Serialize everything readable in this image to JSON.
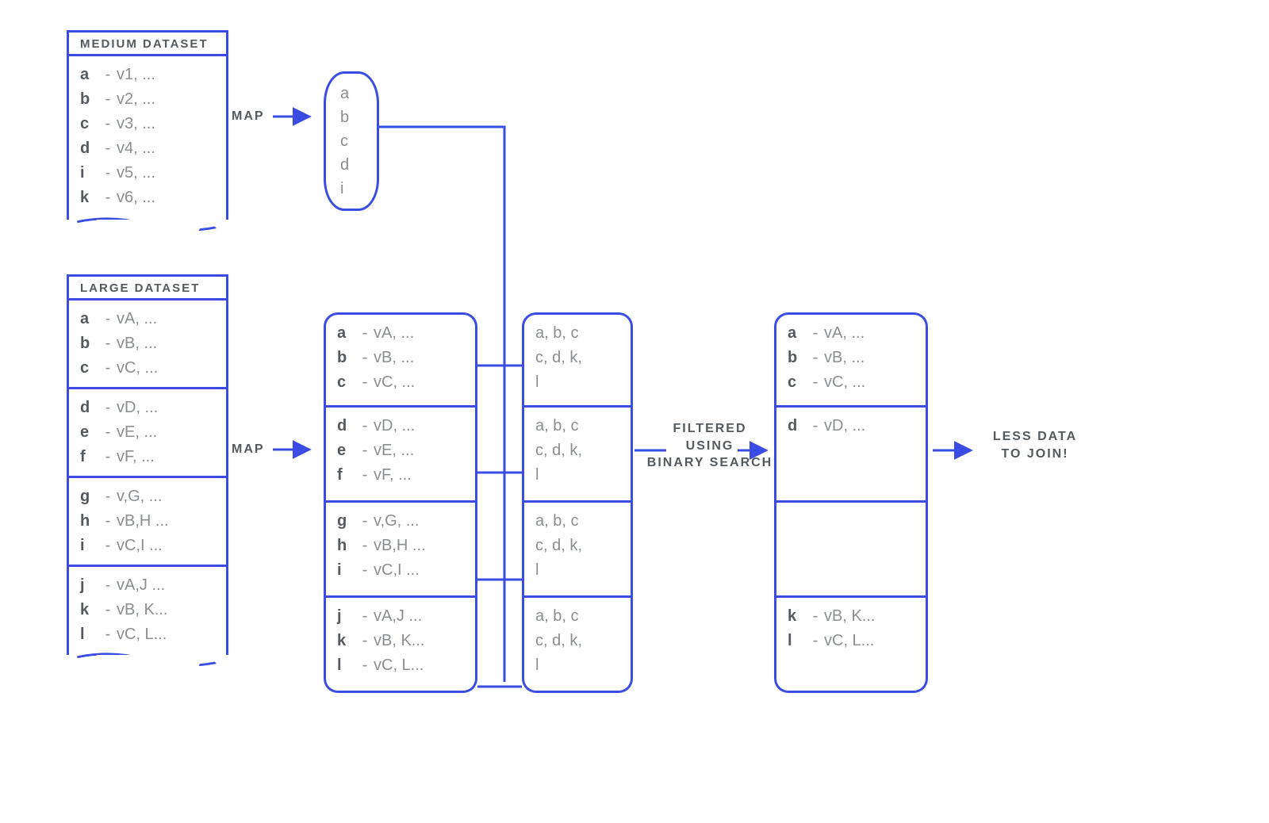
{
  "colors": {
    "stroke": "#3b4ce2",
    "text_dark": "#555a5f",
    "text_light": "#8a8e92"
  },
  "medium": {
    "title": "MEDIUM DATASET",
    "rows": [
      {
        "k": "a",
        "v": "v1, ..."
      },
      {
        "k": "b",
        "v": "v2, ..."
      },
      {
        "k": "c",
        "v": "v3, ..."
      },
      {
        "k": "d",
        "v": "v4, ..."
      },
      {
        "k": "i",
        "v": "v5, ..."
      },
      {
        "k": "k",
        "v": "v6, ..."
      }
    ]
  },
  "large": {
    "title": "LARGE DATASET",
    "rows": [
      {
        "k": "a",
        "v": "vA, ..."
      },
      {
        "k": "b",
        "v": "vB, ..."
      },
      {
        "k": "c",
        "v": "vC, ..."
      },
      {
        "k": "d",
        "v": "vD, ..."
      },
      {
        "k": "e",
        "v": "vE, ..."
      },
      {
        "k": "f",
        "v": "vF, ..."
      },
      {
        "k": "g",
        "v": "v,G, ..."
      },
      {
        "k": "h",
        "v": "vB,H ..."
      },
      {
        "k": "i",
        "v": "vC,I ..."
      },
      {
        "k": "j",
        "v": "vA,J ..."
      },
      {
        "k": "k",
        "v": "vB, K..."
      },
      {
        "k": "l",
        "v": "vC, L..."
      }
    ]
  },
  "ops": {
    "map1": "MAP",
    "map2": "MAP",
    "filter_l1": "FILTERED",
    "filter_l2": "USING",
    "filter_l3": "BINARY SEARCH",
    "out_l1": "LESS DATA",
    "out_l2": "TO JOIN!"
  },
  "keyset": [
    "a",
    "b",
    "c",
    "d",
    "i"
  ],
  "mapped_large": {
    "parts": [
      [
        {
          "k": "a",
          "v": "vA, ..."
        },
        {
          "k": "b",
          "v": "vB, ..."
        },
        {
          "k": "c",
          "v": "vC, ..."
        }
      ],
      [
        {
          "k": "d",
          "v": "vD, ..."
        },
        {
          "k": "e",
          "v": "vE, ..."
        },
        {
          "k": "f",
          "v": "vF, ..."
        }
      ],
      [
        {
          "k": "g",
          "v": "v,G, ..."
        },
        {
          "k": "h",
          "v": "vB,H ..."
        },
        {
          "k": "i",
          "v": "vC,I ..."
        }
      ],
      [
        {
          "k": "j",
          "v": "vA,J ..."
        },
        {
          "k": "k",
          "v": "vB, K..."
        },
        {
          "k": "l",
          "v": "vC, L..."
        }
      ]
    ]
  },
  "broadcast_block": {
    "lines": [
      "a, b, c",
      "c, d, k,",
      "l"
    ]
  },
  "result": {
    "parts": [
      [
        {
          "k": "a",
          "v": "vA, ..."
        },
        {
          "k": "b",
          "v": "vB, ..."
        },
        {
          "k": "c",
          "v": "vC, ..."
        }
      ],
      [
        {
          "k": "d",
          "v": "vD, ..."
        }
      ],
      [],
      [
        {
          "k": "k",
          "v": "vB, K..."
        },
        {
          "k": "l",
          "v": "vC, L..."
        }
      ]
    ]
  },
  "sep": "-"
}
